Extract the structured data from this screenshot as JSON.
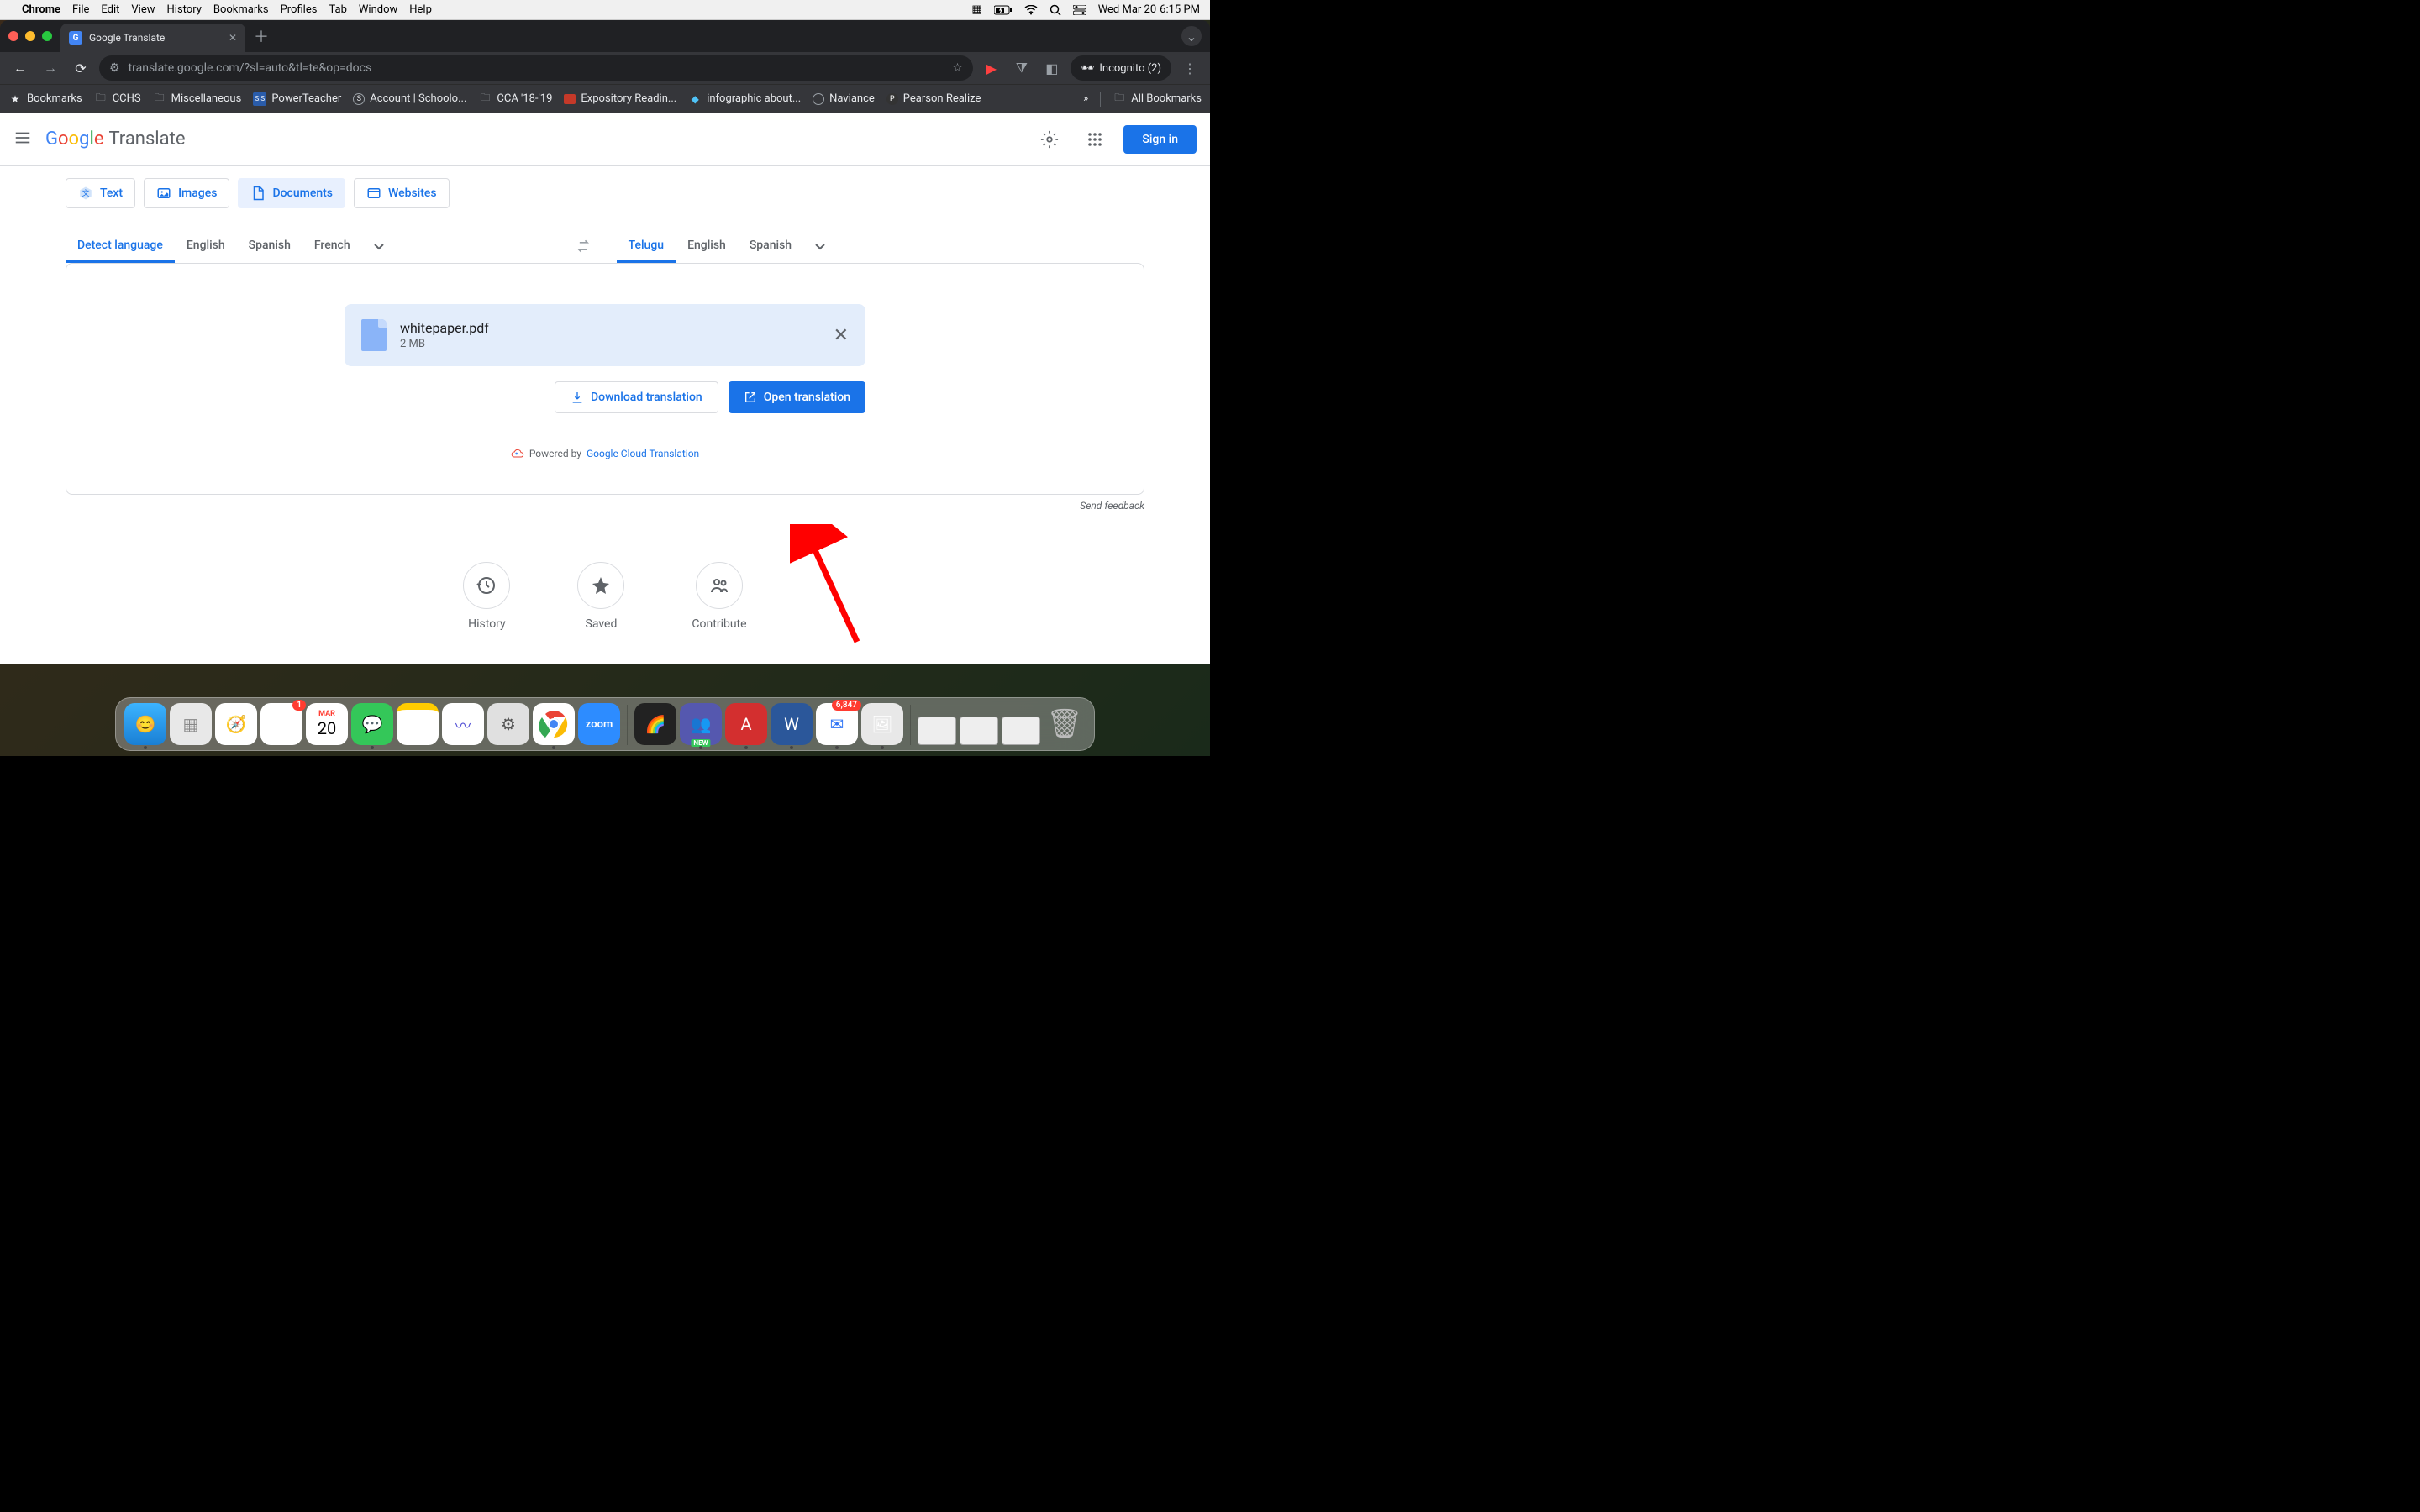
{
  "mac_menu": {
    "app": "Chrome",
    "items": [
      "File",
      "Edit",
      "View",
      "History",
      "Bookmarks",
      "Profiles",
      "Tab",
      "Window",
      "Help"
    ],
    "date": "Wed Mar 20",
    "time": "6:15 PM"
  },
  "browser": {
    "tab_title": "Google Translate",
    "url": "translate.google.com/?sl=auto&tl=te&op=docs",
    "incognito": "Incognito (2)",
    "bookmarks": [
      "Bookmarks",
      "CCHS",
      "Miscellaneous",
      "PowerTeacher",
      "Account | Schoolo...",
      "CCA '18-'19",
      "Expository Readin...",
      "infographic about...",
      "Naviance",
      "Pearson Realize"
    ],
    "all_bookmarks": "All Bookmarks"
  },
  "gt": {
    "logo_suffix": "Translate",
    "signin": "Sign in",
    "modes": {
      "text": "Text",
      "images": "Images",
      "documents": "Documents",
      "websites": "Websites"
    },
    "src_langs": [
      "Detect language",
      "English",
      "Spanish",
      "French"
    ],
    "tgt_langs": [
      "Telugu",
      "English",
      "Spanish"
    ],
    "file": {
      "name": "whitepaper.pdf",
      "size": "2 MB"
    },
    "download": "Download translation",
    "open": "Open translation",
    "powered_prefix": "Powered by ",
    "powered_link": "Google Cloud Translation",
    "feedback": "Send feedback",
    "bottom": {
      "history": "History",
      "saved": "Saved",
      "contribute": "Contribute"
    }
  },
  "dock": {
    "badges": {
      "photos": "1",
      "calendar_month": "MAR",
      "calendar_day": "20",
      "mail": "6,847",
      "teams_new": "NEW"
    }
  }
}
